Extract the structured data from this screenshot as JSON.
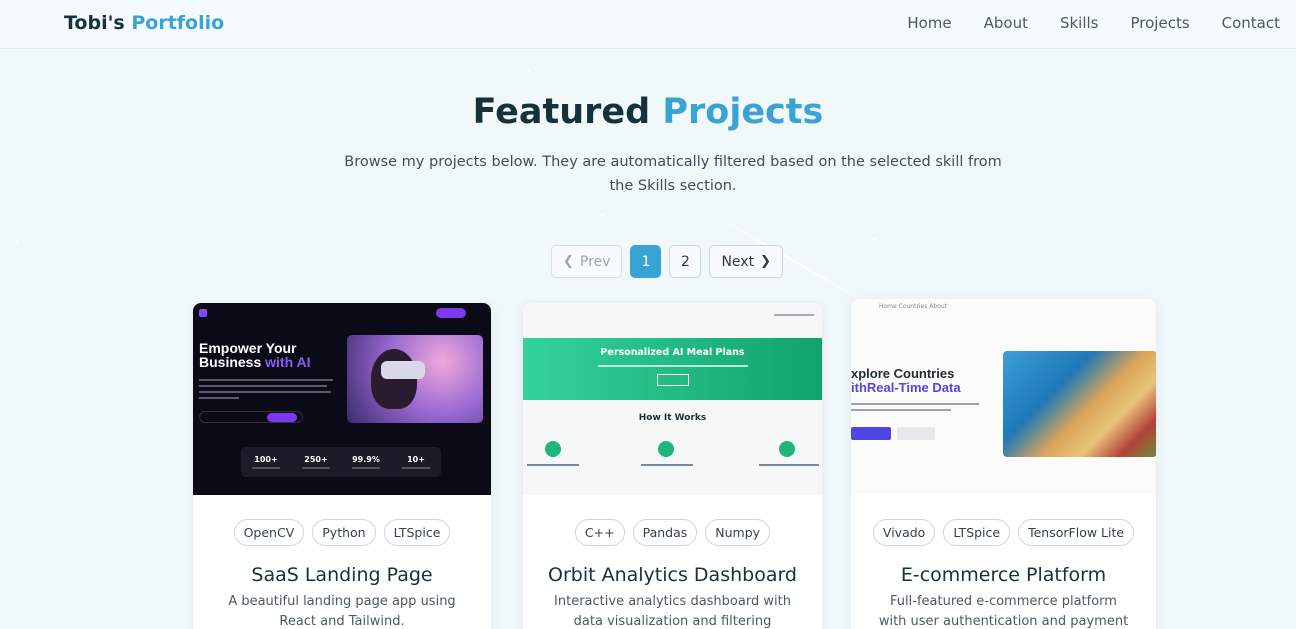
{
  "navbar": {
    "brand_first": "Tobi's",
    "brand_second": "Portfolio",
    "links": [
      "Home",
      "About",
      "Skills",
      "Projects",
      "Contact"
    ]
  },
  "section": {
    "title_first": "Featured",
    "title_accent": "Projects",
    "subtitle": "Browse my projects below. They are automatically filtered based on the selected skill from the Skills section."
  },
  "pagination": {
    "prev": "Prev",
    "pages": [
      "1",
      "2"
    ],
    "active_page": "1",
    "next": "Next"
  },
  "colors": {
    "accent": "#3aa3d6",
    "heading": "#17313b"
  },
  "projects": [
    {
      "tags": [
        "OpenCV",
        "Python",
        "LTSpice"
      ],
      "title": "SaaS Landing Page",
      "description": "A beautiful landing page app using React and Tailwind.",
      "preview": {
        "headline_1": "Empower Your",
        "headline_2": "Business",
        "headline_accent": "with AI",
        "stats": [
          "100+",
          "250+",
          "99.9%",
          "10+"
        ]
      }
    },
    {
      "tags": [
        "C++",
        "Pandas",
        "Numpy"
      ],
      "title": "Orbit Analytics Dashboard",
      "description": "Interactive analytics dashboard with data visualization and filtering",
      "preview": {
        "banner_title": "Personalized AI Meal Plans",
        "section_title": "How It Works"
      }
    },
    {
      "tags": [
        "Vivado",
        "LTSpice",
        "TensorFlow Lite"
      ],
      "title": "E-commerce Platform",
      "description": "Full-featured e-commerce platform with user authentication and payment",
      "preview": {
        "nav": "Home   Countries   About",
        "headline_1": "xplore Countries",
        "headline_2_prefix": "ith",
        "headline_accent": "Real-Time Data"
      }
    }
  ]
}
